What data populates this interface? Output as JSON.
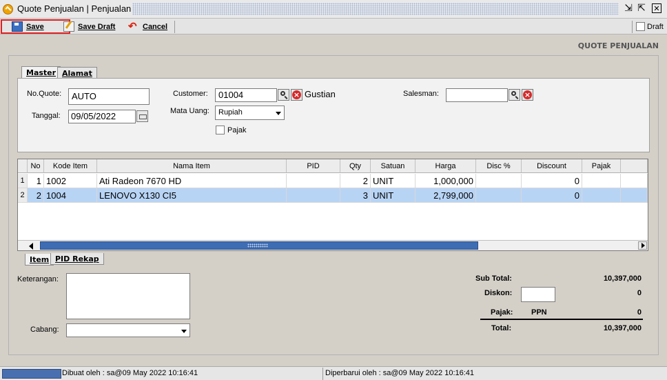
{
  "window": {
    "title": "Quote Penjualan | Penjualan"
  },
  "toolbar": {
    "save": "Save",
    "save_draft": "Save Draft",
    "cancel": "Cancel",
    "draft": "Draft",
    "draft_checked": false
  },
  "form": {
    "doc_label": "QUOTE PENJUALAN",
    "tabs": [
      "Master",
      "Alamat"
    ],
    "no_quote_label": "No.Quote:",
    "no_quote": "AUTO",
    "tanggal_label": "Tanggal:",
    "tanggal": "09/05/2022",
    "customer_label": "Customer:",
    "customer_code": "01004",
    "customer_name": "Gustian",
    "mata_uang_label": "Mata Uang:",
    "mata_uang": "Rupiah",
    "pajak_label": "Pajak",
    "salesman_label": "Salesman:",
    "salesman": ""
  },
  "grid": {
    "columns": [
      "No",
      "Kode Item",
      "Nama Item",
      "PID",
      "Qty",
      "Satuan",
      "Harga",
      "Disc %",
      "Discount",
      "Pajak"
    ],
    "rows": [
      {
        "row": "1",
        "no": "1",
        "kode": "1002",
        "nama": "Ati Radeon 7670 HD",
        "pid": "",
        "qty": "2",
        "satuan": "UNIT",
        "harga": "1,000,000",
        "disc": "",
        "discount": "0",
        "pajak": ""
      },
      {
        "row": "2",
        "no": "2",
        "kode": "1004",
        "nama": "LENOVO X130 CI5",
        "pid": "",
        "qty": "3",
        "satuan": "UNIT",
        "harga": "2,799,000",
        "disc": "",
        "discount": "0",
        "pajak": ""
      }
    ]
  },
  "bottom_tabs": [
    "Item",
    "PID Rekap"
  ],
  "footer": {
    "keterangan_label": "Keterangan:",
    "cabang_label": "Cabang:",
    "subtotal_label": "Sub Total:",
    "subtotal": "10,397,000",
    "diskon_label": "Diskon:",
    "diskon": "0",
    "pajak_label": "Pajak:",
    "pajak_type": "PPN",
    "pajak": "0",
    "total_label": "Total:",
    "total": "10,397,000"
  },
  "status": {
    "created": "Dibuat oleh : sa@09 May 2022  10:16:41",
    "updated": "Diperbarui oleh : sa@09 May 2022  10:16:41"
  },
  "colors": {
    "selected_row": "#b8d4f5",
    "save_highlight": "#e02020",
    "status_accent": "#4a6fb0"
  }
}
